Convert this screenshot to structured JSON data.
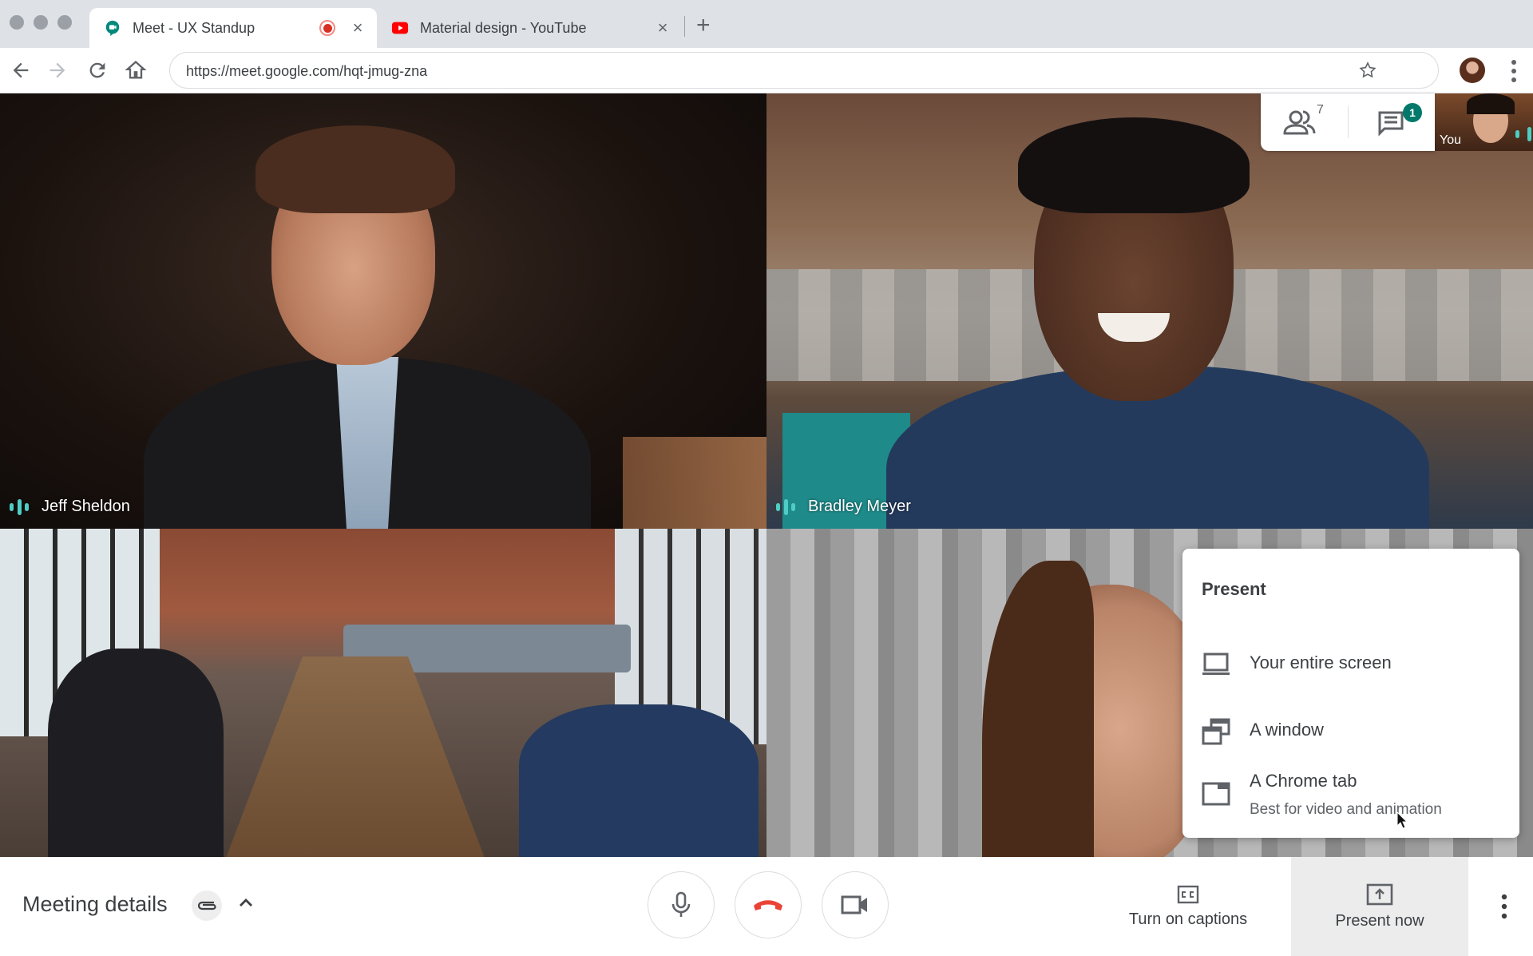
{
  "browser": {
    "tabs": [
      {
        "title": "Meet - UX Standup",
        "active": true,
        "recording": true,
        "favicon": "meet-icon"
      },
      {
        "title": "Material design - YouTube",
        "active": false,
        "favicon": "youtube-icon"
      }
    ],
    "new_tab_label": "+",
    "close_glyph": "×",
    "url": "https://meet.google.com/hqt-jmug-zna"
  },
  "meeting": {
    "participants": [
      {
        "name": "Jeff Sheldon",
        "speaking": true
      },
      {
        "name": "Bradley Meyer",
        "speaking": true
      },
      {
        "name": "",
        "speaking": false
      },
      {
        "name": "",
        "speaking": false
      }
    ],
    "people_count": "7",
    "chat_unread": "1",
    "self_label": "You",
    "speaking_color": "#4ecdc4"
  },
  "present_menu": {
    "title": "Present",
    "items": [
      {
        "label": "Your entire screen",
        "sub": "",
        "icon": "laptop-icon"
      },
      {
        "label": "A window",
        "sub": "",
        "icon": "window-icon"
      },
      {
        "label": "A Chrome tab",
        "sub": "Best for video and animation",
        "icon": "chrome-tab-icon"
      }
    ]
  },
  "bottom_bar": {
    "meeting_details_label": "Meeting details",
    "captions_label": "Turn on captions",
    "present_now_label": "Present now",
    "hangup_color": "#ea4335"
  }
}
